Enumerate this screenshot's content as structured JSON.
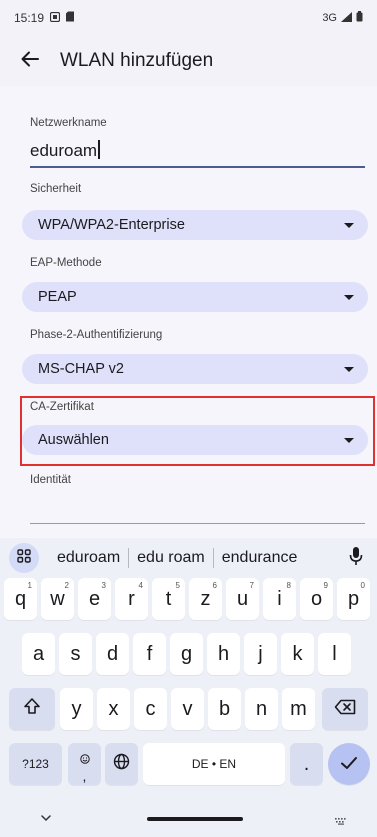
{
  "status_bar": {
    "time": "15:19",
    "network": "3G"
  },
  "app_bar": {
    "title": "WLAN hinzufügen"
  },
  "form": {
    "network_name": {
      "label": "Netzwerkname",
      "value": "eduroam"
    },
    "security": {
      "label": "Sicherheit",
      "value": "WPA/WPA2-Enterprise"
    },
    "eap_method": {
      "label": "EAP-Methode",
      "value": "PEAP"
    },
    "phase2": {
      "label": "Phase-2-Authentifizierung",
      "value": "MS-CHAP v2"
    },
    "ca_cert": {
      "label": "CA-Zertifikat",
      "value": "Auswählen"
    },
    "identity": {
      "label": "Identität",
      "value": ""
    }
  },
  "suggestions": [
    "eduroam",
    "edu roam",
    "endurance"
  ],
  "keyboard": {
    "row1": [
      {
        "k": "q",
        "h": "1"
      },
      {
        "k": "w",
        "h": "2"
      },
      {
        "k": "e",
        "h": "3"
      },
      {
        "k": "r",
        "h": "4"
      },
      {
        "k": "t",
        "h": "5"
      },
      {
        "k": "z",
        "h": "6"
      },
      {
        "k": "u",
        "h": "7"
      },
      {
        "k": "i",
        "h": "8"
      },
      {
        "k": "o",
        "h": "9"
      },
      {
        "k": "p",
        "h": "0"
      }
    ],
    "row2": [
      "a",
      "s",
      "d",
      "f",
      "g",
      "h",
      "j",
      "k",
      "l"
    ],
    "row3": [
      "y",
      "x",
      "c",
      "v",
      "b",
      "n",
      "m"
    ],
    "symbols_label": "?123",
    "emoji_comma": ",",
    "space_label": "DE • EN",
    "period": "."
  },
  "colors": {
    "accent": "#4b5c92",
    "dropdown_bg": "#dfe1fa",
    "highlight": "#e0312f",
    "enter_bg": "#b6c2f1"
  }
}
